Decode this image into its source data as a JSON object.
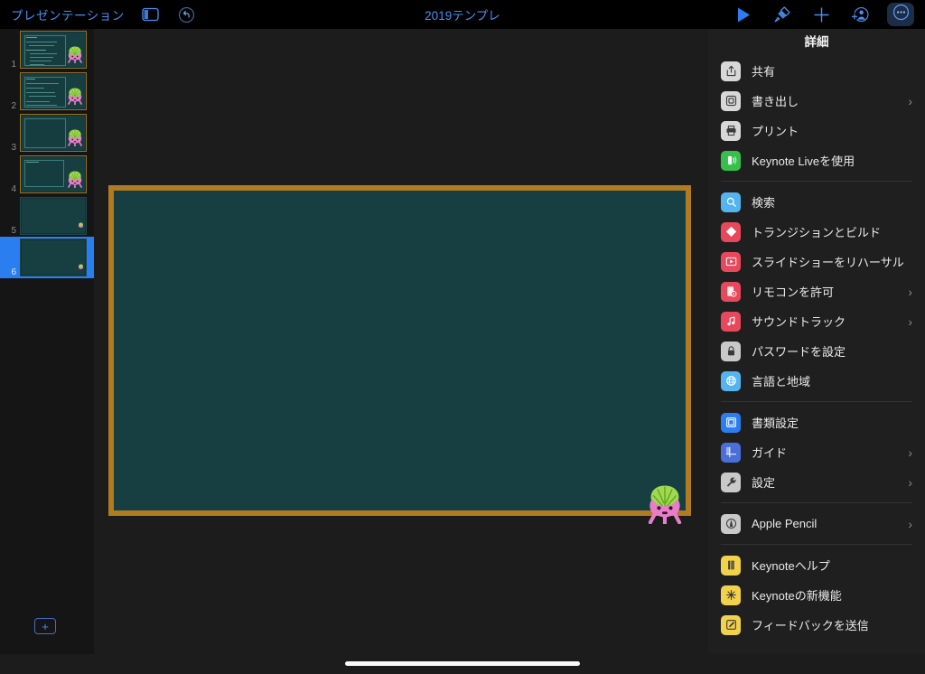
{
  "toolbar": {
    "doc_label": "プレゼンテーション",
    "title": "2019テンプレ",
    "sidebar_icon": "sidebar-toggle-icon",
    "undo_icon": "undo-icon",
    "play_icon": "play-icon",
    "format_icon": "paintbrush-icon",
    "insert_icon": "plus-icon",
    "collaborate_icon": "add-person-icon",
    "more_icon": "ellipsis-circle-icon",
    "accent_color": "#4a8ef0",
    "more_button_bg": "#1d2c47"
  },
  "navigator": {
    "add_slide_label": "+",
    "selected_index": 6,
    "slides": [
      {
        "number": "1",
        "has_text": true,
        "has_mascot": true,
        "text_lines": 8
      },
      {
        "number": "2",
        "has_text": true,
        "has_mascot": true,
        "text_lines": 7
      },
      {
        "number": "3",
        "has_text": false,
        "has_mascot": true,
        "text_lines": 0
      },
      {
        "number": "4",
        "has_text": true,
        "has_mascot": true,
        "text_lines": 1
      },
      {
        "number": "5",
        "has_text": false,
        "has_mascot": false,
        "text_lines": 0
      },
      {
        "number": "6",
        "has_text": false,
        "has_mascot": false,
        "text_lines": 0
      }
    ]
  },
  "canvas": {
    "slide_frame_color": "#b07b21",
    "slide_board_color": "#173e41",
    "background_color": "#1c1c1c",
    "mascot_name": "pink-alien-mascot"
  },
  "panel": {
    "title": "詳細",
    "groups": [
      {
        "items": [
          {
            "label": "共有",
            "icon": "share-icon",
            "icon_bg": "#d8d8d8",
            "icon_fg": "#333333",
            "chevron": false
          },
          {
            "label": "書き出し",
            "icon": "export-icon",
            "icon_bg": "#d8d8d8",
            "icon_fg": "#333333",
            "chevron": true
          },
          {
            "label": "プリント",
            "icon": "printer-icon",
            "icon_bg": "#d8d8d8",
            "icon_fg": "#333333",
            "chevron": false
          },
          {
            "label": "Keynote Liveを使用",
            "icon": "keynote-live-icon",
            "icon_bg": "#36c04a",
            "icon_fg": "#ffffff",
            "chevron": false
          }
        ]
      },
      {
        "items": [
          {
            "label": "検索",
            "icon": "search-icon",
            "icon_bg": "#54b4f0",
            "icon_fg": "#ffffff",
            "chevron": false
          },
          {
            "label": "トランジションとビルド",
            "icon": "transition-icon",
            "icon_bg": "#e8485c",
            "icon_fg": "#ffffff",
            "chevron": false
          },
          {
            "label": "スライドショーをリハーサル",
            "icon": "rehearse-play-icon",
            "icon_bg": "#e8485c",
            "icon_fg": "#ffffff",
            "chevron": false
          },
          {
            "label": "リモコンを許可",
            "icon": "remote-icon",
            "icon_bg": "#e8485c",
            "icon_fg": "#ffffff",
            "chevron": true
          },
          {
            "label": "サウンドトラック",
            "icon": "music-note-icon",
            "icon_bg": "#e8485c",
            "icon_fg": "#ffffff",
            "chevron": true
          },
          {
            "label": "パスワードを設定",
            "icon": "lock-icon",
            "icon_bg": "#c9c9c9",
            "icon_fg": "#333333",
            "chevron": false
          },
          {
            "label": "言語と地域",
            "icon": "globe-icon",
            "icon_bg": "#54b4f0",
            "icon_fg": "#ffffff",
            "chevron": false
          }
        ]
      },
      {
        "items": [
          {
            "label": "書類設定",
            "icon": "document-setup-icon",
            "icon_bg": "#2b7ef0",
            "icon_fg": "#ffffff",
            "chevron": false
          },
          {
            "label": "ガイド",
            "icon": "guides-icon",
            "icon_bg": "#4a6fd8",
            "icon_fg": "#ffffff",
            "chevron": true
          },
          {
            "label": "設定",
            "icon": "wrench-icon",
            "icon_bg": "#c9c9c9",
            "icon_fg": "#333333",
            "chevron": true
          }
        ]
      },
      {
        "items": [
          {
            "label": "Apple Pencil",
            "icon": "apple-pencil-icon",
            "icon_bg": "#c9c9c9",
            "icon_fg": "#333333",
            "chevron": true
          }
        ]
      },
      {
        "items": [
          {
            "label": "Keynoteヘルプ",
            "icon": "help-book-icon",
            "icon_bg": "#f2d14b",
            "icon_fg": "#333333",
            "chevron": false
          },
          {
            "label": "Keynoteの新機能",
            "icon": "whats-new-icon",
            "icon_bg": "#f2d14b",
            "icon_fg": "#333333",
            "chevron": false
          },
          {
            "label": "フィードバックを送信",
            "icon": "feedback-icon",
            "icon_bg": "#f2d14b",
            "icon_fg": "#333333",
            "chevron": false
          }
        ]
      }
    ]
  }
}
